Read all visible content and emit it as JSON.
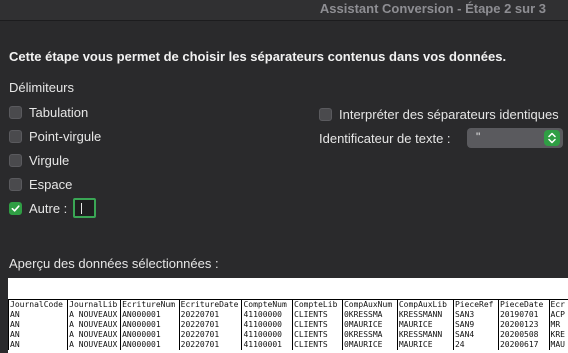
{
  "window": {
    "title": "Assistant Conversion - Étape 2 sur 3"
  },
  "intro": "Cette étape vous permet de choisir les séparateurs contenus dans vos données.",
  "delimiters": {
    "label": "Délimiteurs",
    "items": [
      {
        "label": "Tabulation",
        "checked": false
      },
      {
        "label": "Point-virgule",
        "checked": false
      },
      {
        "label": "Virgule",
        "checked": false
      },
      {
        "label": "Espace",
        "checked": false
      },
      {
        "label": "Autre :",
        "checked": true
      }
    ],
    "other_value": ""
  },
  "options": {
    "consecutive_label": "Interpréter des séparateurs identiques",
    "consecutive_checked": false,
    "qualifier_label": "Identificateur de texte :",
    "qualifier_value": "\""
  },
  "preview": {
    "label": "Aperçu des données sélectionnées :",
    "columns": [
      "JournalCode",
      "JournalLib",
      "EcritureNum",
      "EcritureDate",
      "CompteNum",
      "CompteLib",
      "CompAuxNum",
      "CompAuxLib",
      "PieceRef",
      "PieceDate",
      "Ecr"
    ],
    "rows": [
      [
        "AN",
        "A NOUVEAUX",
        "AN000001",
        "20220701",
        "41100000",
        "CLIENTS",
        "0KRESSMA",
        "KRESSMANN",
        "SAN3",
        "20190701",
        "ACP"
      ],
      [
        "AN",
        "A NOUVEAUX",
        "AN000001",
        "20220701",
        "41100000",
        "CLIENTS",
        "0MAURICE",
        "MAURICE",
        "SAN9",
        "20200123",
        "MR"
      ],
      [
        "AN",
        "A NOUVEAUX",
        "AN000001",
        "20220701",
        "41100000",
        "CLIENTS",
        "0KRESSMA",
        "KRESSMANN",
        "SAN4",
        "20200508",
        "KRE"
      ],
      [
        "AN",
        "A NOUVEAUX",
        "AN000001",
        "20220701",
        "41100001",
        "CLIENTS",
        "0MAURICE",
        "MAURICE",
        "24",
        "20200617",
        "MAU"
      ]
    ]
  }
}
